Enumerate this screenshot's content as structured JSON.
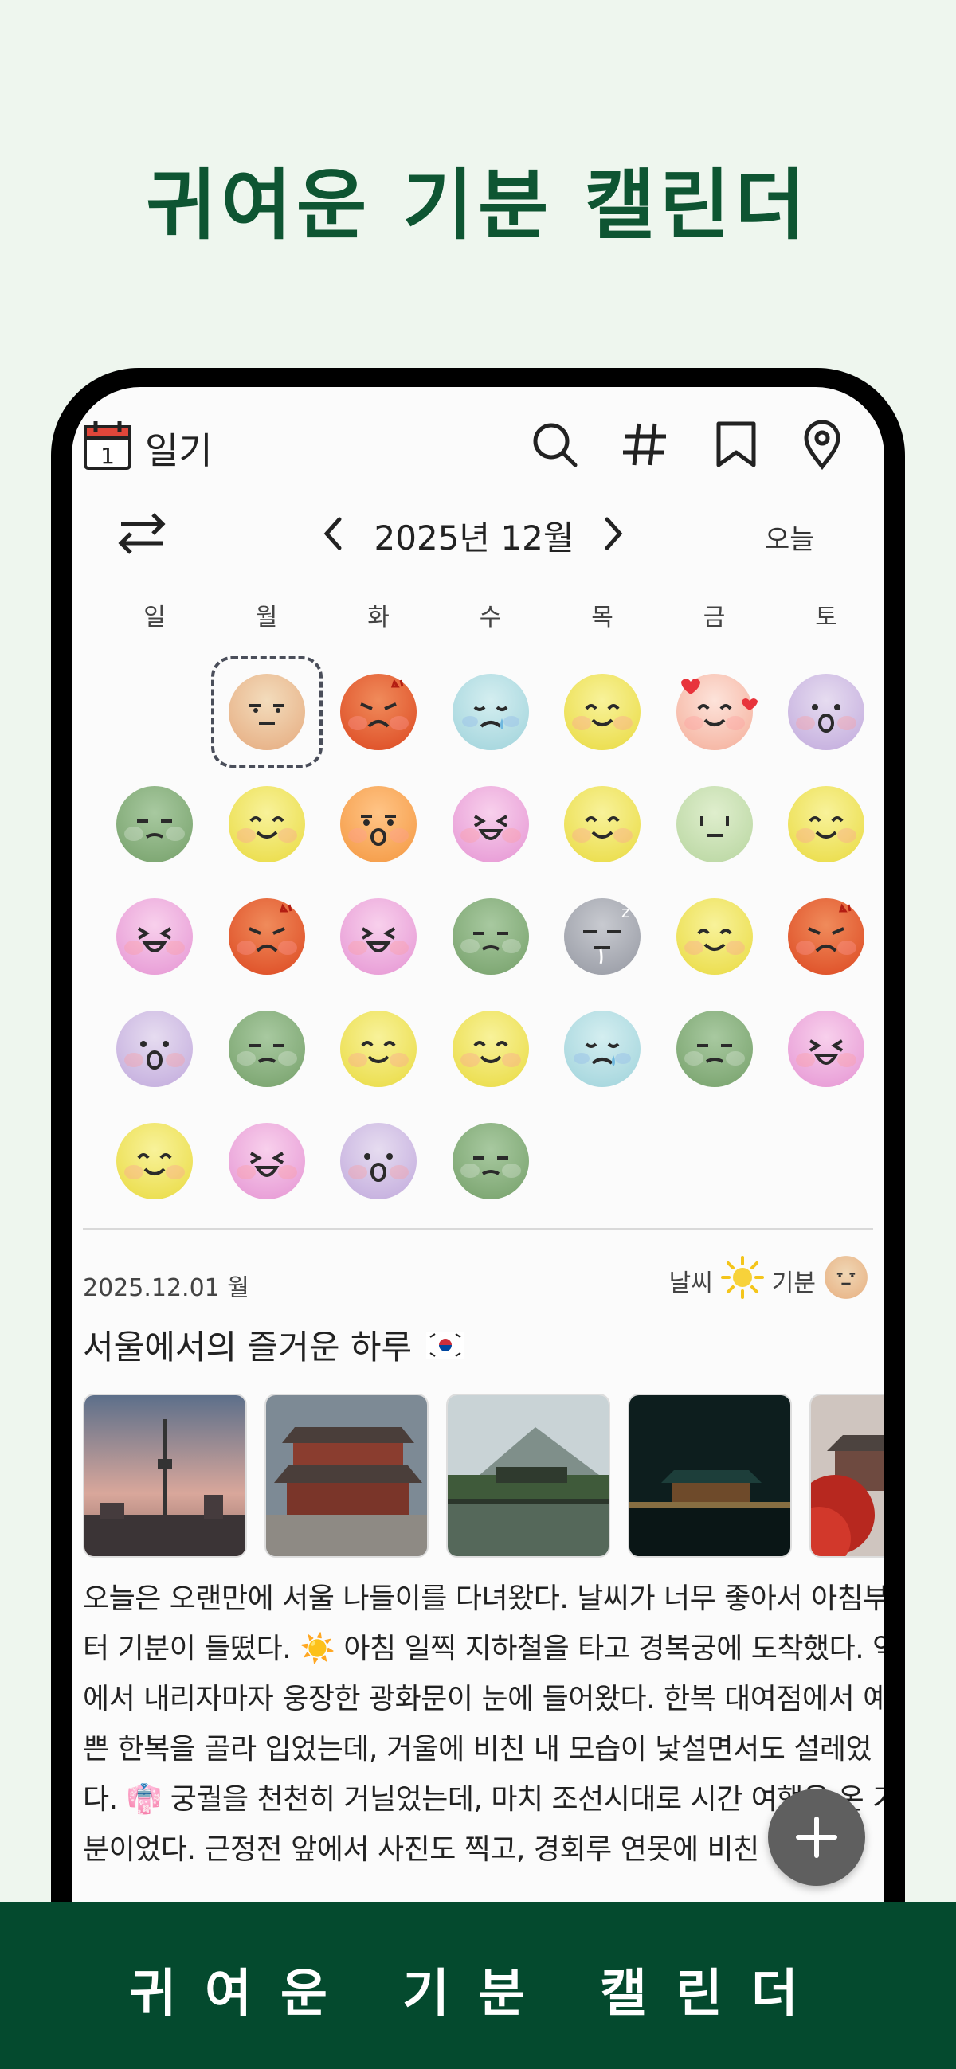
{
  "promo": {
    "title": "귀여운 기분 캘린더",
    "bottom_banner": "귀여운 기분 캘린더"
  },
  "app": {
    "title": "일기",
    "logo_day": "1"
  },
  "calendar": {
    "month_label": "2025년 12월",
    "today_label": "오늘",
    "weekdays": [
      "일",
      "월",
      "화",
      "수",
      "목",
      "금",
      "토"
    ],
    "days": [
      {
        "mood": "neutral-peach",
        "selected": true
      },
      {
        "mood": "angry"
      },
      {
        "mood": "sad"
      },
      {
        "mood": "happy"
      },
      {
        "mood": "love"
      },
      {
        "mood": "surprised"
      },
      {
        "mood": "meh-green"
      },
      {
        "mood": "happy"
      },
      {
        "mood": "shocked"
      },
      {
        "mood": "laugh"
      },
      {
        "mood": "happy"
      },
      {
        "mood": "calm"
      },
      {
        "mood": "happy"
      },
      {
        "mood": "laugh"
      },
      {
        "mood": "angry"
      },
      {
        "mood": "laugh"
      },
      {
        "mood": "meh-green"
      },
      {
        "mood": "sleepy"
      },
      {
        "mood": "happy"
      },
      {
        "mood": "angry"
      },
      {
        "mood": "surprised"
      },
      {
        "mood": "meh-green"
      },
      {
        "mood": "happy"
      },
      {
        "mood": "happy"
      },
      {
        "mood": "sad"
      },
      {
        "mood": "meh-green"
      },
      {
        "mood": "laugh"
      },
      {
        "mood": "happy"
      },
      {
        "mood": "laugh"
      },
      {
        "mood": "surprised"
      },
      {
        "mood": "meh-green"
      }
    ],
    "first_weekday_index": 1
  },
  "entry": {
    "date": "2025.12.01 월",
    "weather_label": "날씨",
    "mood_label": "기분",
    "title": "서울에서의 즐거운 하루",
    "body_lines": [
      "오늘은 오랜만에 서울 나들이를 다녀왔다. 날씨가 너무 좋아서 아침부",
      "터 기분이 들떴다. ☀️ 아침 일찍 지하철을 타고 경복궁에 도착했다. 역",
      "에서 내리자마자 웅장한 광화문이 눈에 들어왔다. 한복 대여점에서 예",
      "쁜 한복을 골라 입었는데, 거울에 비친 내 모습이 낯설면서도 설레었",
      "다. 👘 궁궐을 천천히 거닐었는데, 마치 조선시대로 시간 여행을 온 기",
      "분이었다. 근정전 앞에서 사진도 찍고, 경회루 연못에 비친 하"
    ]
  },
  "colors": {
    "brand": "#0e5532",
    "banner": "#044a2e",
    "fab": "#5f5f5f"
  }
}
